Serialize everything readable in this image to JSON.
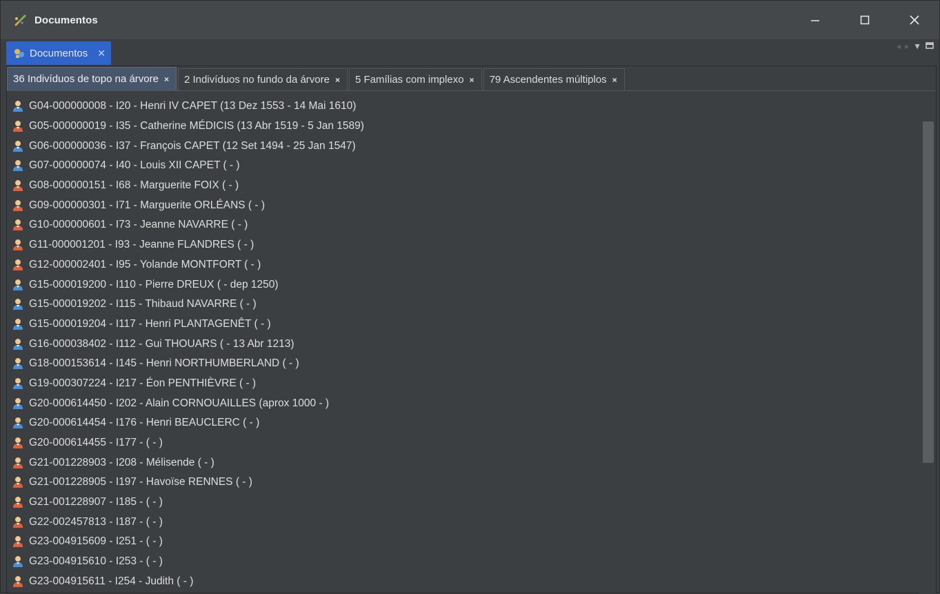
{
  "window": {
    "title": "Documentos",
    "controls": {
      "minimize": "—",
      "maximize": "☐",
      "close": "✕"
    }
  },
  "doc_tab": {
    "label": "Documentos",
    "close": "✕"
  },
  "inner_tabs": [
    {
      "label": "36 Indivíduos de topo na árvore",
      "close": "×",
      "active": true
    },
    {
      "label": "2 Indivíduos no fundo da árvore",
      "close": "×",
      "active": false
    },
    {
      "label": "5 Famílias com implexo",
      "close": "×",
      "active": false
    },
    {
      "label": "79 Ascendentes múltiplos",
      "close": "×",
      "active": false
    }
  ],
  "colors": {
    "male_icon": "#4a90d9",
    "female_icon": "#e0623a",
    "active_doc_tab": "#2f65ca"
  },
  "rows": [
    {
      "text": "G04-000000008 - I20 - Henri IV CAPET (13 Dez 1553 - 14 Mai 1610)",
      "sex": "male"
    },
    {
      "text": "G05-000000019 - I35 - Catherine MÉDICIS (13 Abr 1519 - 5 Jan 1589)",
      "sex": "female"
    },
    {
      "text": "G06-000000036 - I37 - François CAPET (12 Set 1494 - 25 Jan 1547)",
      "sex": "male"
    },
    {
      "text": "G07-000000074 - I40 - Louis XII CAPET ( - )",
      "sex": "male"
    },
    {
      "text": "G08-000000151 - I68 - Marguerite FOIX ( - )",
      "sex": "female"
    },
    {
      "text": "G09-000000301 - I71 - Marguerite ORLÉANS ( - )",
      "sex": "female"
    },
    {
      "text": "G10-000000601 - I73 - Jeanne NAVARRE ( - )",
      "sex": "female"
    },
    {
      "text": "G11-000001201 - I93 - Jeanne FLANDRES ( - )",
      "sex": "female"
    },
    {
      "text": "G12-000002401 - I95 - Yolande MONTFORT ( - )",
      "sex": "female"
    },
    {
      "text": "G15-000019200 - I110 - Pierre DREUX ( - dep 1250)",
      "sex": "male"
    },
    {
      "text": "G15-000019202 - I115 - Thibaud NAVARRE ( - )",
      "sex": "male"
    },
    {
      "text": "G15-000019204 - I117 - Henri PLANTAGENÊT ( - )",
      "sex": "male"
    },
    {
      "text": "G16-000038402 - I112 - Gui THOUARS ( - 13 Abr 1213)",
      "sex": "male"
    },
    {
      "text": "G18-000153614 - I145 - Henri NORTHUMBERLAND ( - )",
      "sex": "male"
    },
    {
      "text": "G19-000307224 - I217 - Éon PENTHIÈVRE ( - )",
      "sex": "male"
    },
    {
      "text": "G20-000614450 - I202 - Alain CORNOUAILLES (aprox 1000 - )",
      "sex": "male"
    },
    {
      "text": "G20-000614454 - I176 - Henri BEAUCLERC ( - )",
      "sex": "male"
    },
    {
      "text": "G20-000614455 - I177 -  ( - )",
      "sex": "female"
    },
    {
      "text": "G21-001228903 - I208 - Mélisende  ( - )",
      "sex": "female"
    },
    {
      "text": "G21-001228905 - I197 - Havoïse RENNES ( - )",
      "sex": "female"
    },
    {
      "text": "G21-001228907 - I185 -  ( - )",
      "sex": "female"
    },
    {
      "text": "G22-002457813 - I187 -  ( - )",
      "sex": "female"
    },
    {
      "text": "G23-004915609 - I251 -  ( - )",
      "sex": "female"
    },
    {
      "text": "G23-004915610 - I253 -  ( - )",
      "sex": "male"
    },
    {
      "text": "G23-004915611 - I254 - Judith  ( - )",
      "sex": "female"
    }
  ]
}
